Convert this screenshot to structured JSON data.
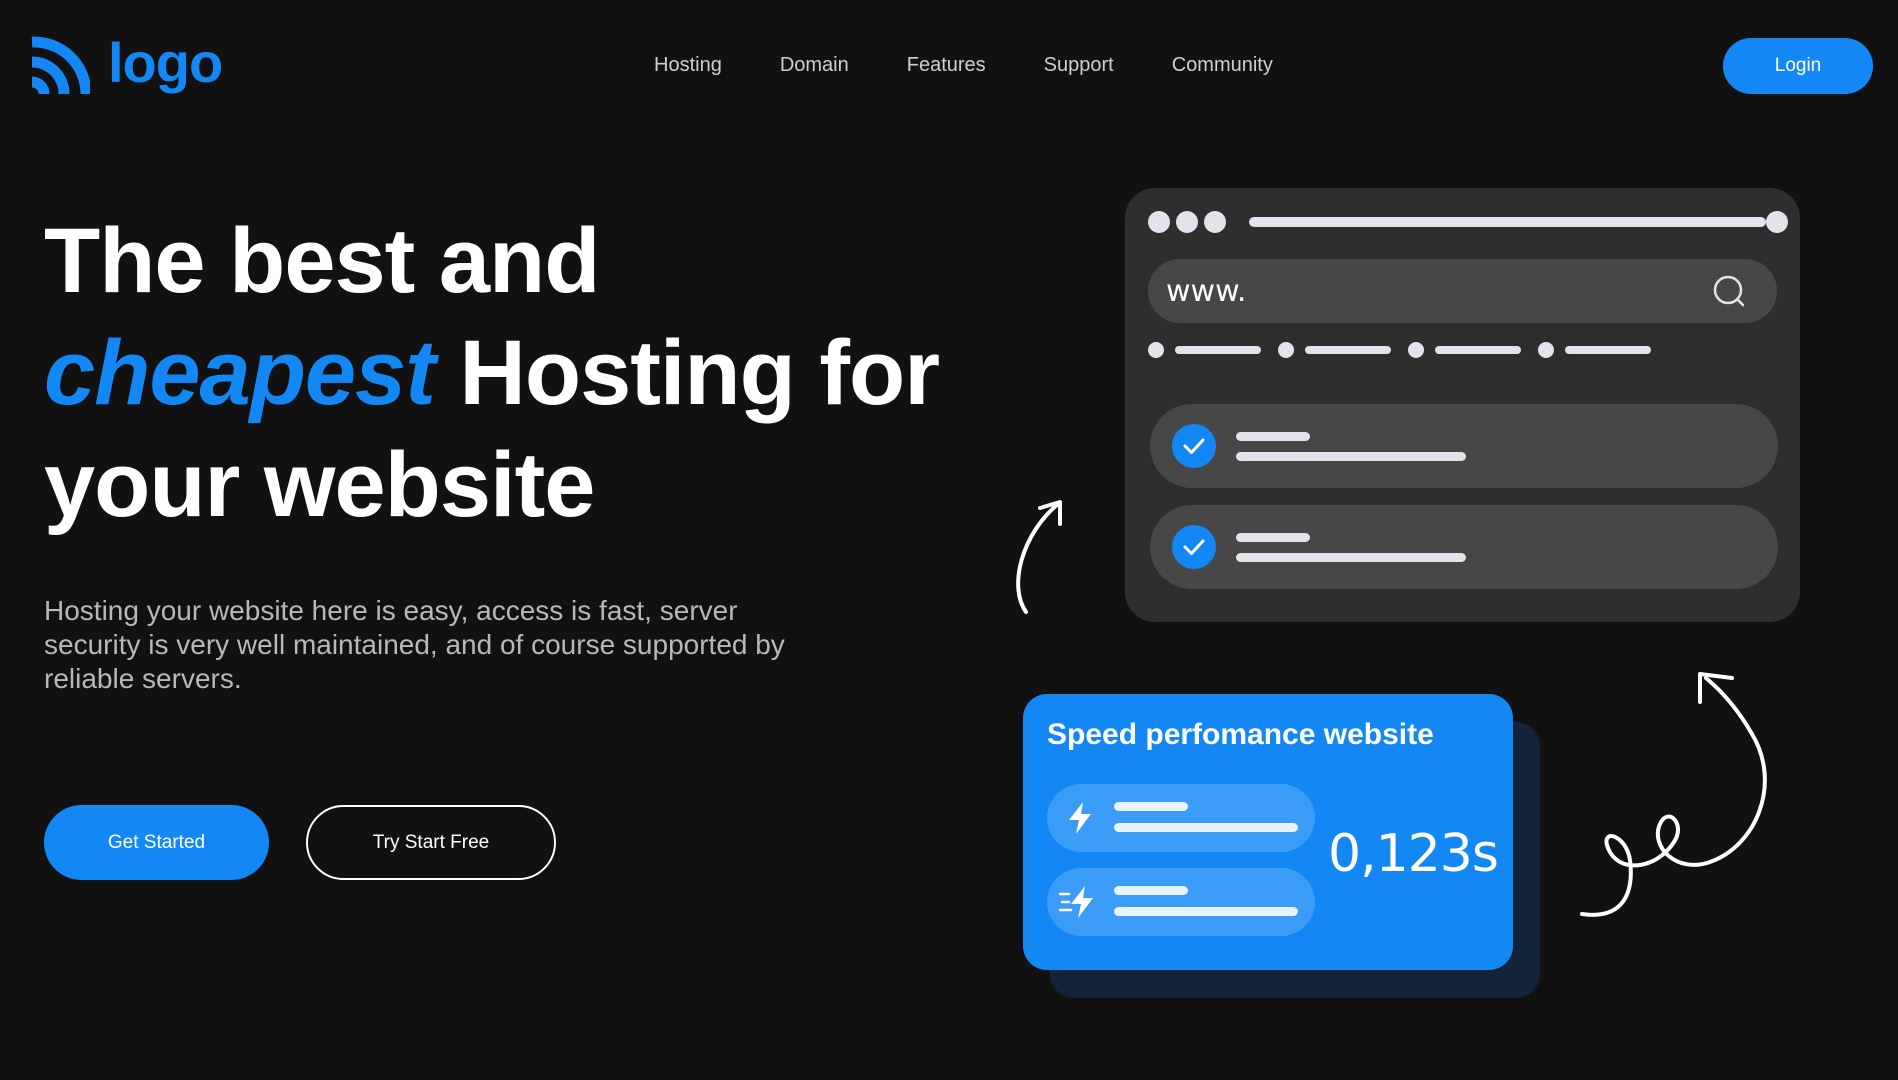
{
  "header": {
    "logo_text": "logo",
    "nav": [
      "Hosting",
      "Domain",
      "Features",
      "Support",
      "Community"
    ],
    "login_label": "Login"
  },
  "hero": {
    "headline_line1": "The best and",
    "headline_accent": "cheapest",
    "headline_line2_rest": " Hosting for",
    "headline_line3": "your website",
    "description": "Hosting your website here is easy, access is fast, server security is very well maintained, and of course supported by reliable servers.",
    "primary_button": "Get Started",
    "secondary_button": "Try Start Free"
  },
  "browser_mock": {
    "url_value": "www.",
    "icons": [
      "search-icon",
      "check-icon"
    ]
  },
  "speed_card": {
    "title": "Speed perfomance website",
    "value": "0,123s",
    "icons": [
      "lightning-icon",
      "fast-lightning-icon"
    ]
  },
  "colors": {
    "background": "#111111",
    "accent": "#1388f5",
    "card_dark": "#2e2e2e",
    "card_row": "#474747",
    "speed_shadow": "#13243a"
  }
}
